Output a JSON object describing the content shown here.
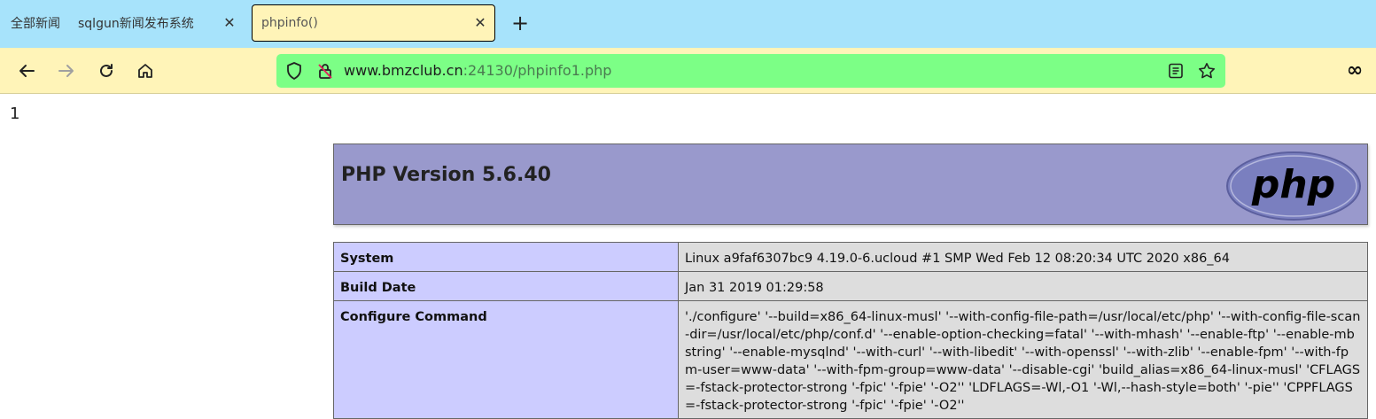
{
  "browser": {
    "tabs": [
      {
        "label": "全部新闻",
        "group": "sqlgun新闻发布系统",
        "active": false
      },
      {
        "label": "phpinfo()",
        "active": true
      }
    ],
    "url": {
      "host": "www.bmzclub.cn",
      "rest": ":24130/phpinfo1.php"
    },
    "colors": {
      "tabbar": "#a7e3fb",
      "toolbar": "#fff4b8",
      "urlbar": "#7cff86"
    }
  },
  "page": {
    "top_text": "1",
    "php_version_title": "PHP Version 5.6.40",
    "logo_text": "php",
    "rows": [
      {
        "key": "System",
        "value": "Linux a9faf6307bc9 4.19.0-6.ucloud #1 SMP Wed Feb 12 08:20:34 UTC 2020 x86_64"
      },
      {
        "key": "Build Date",
        "value": "Jan 31 2019 01:29:58"
      },
      {
        "key": "Configure Command",
        "value": "'./configure' '--build=x86_64-linux-musl' '--with-config-file-path=/usr/local/etc/php' '--with-config-file-scan-dir=/usr/local/etc/php/conf.d' '--enable-option-checking=fatal' '--with-mhash' '--enable-ftp' '--enable-mbstring' '--enable-mysqlnd' '--with-curl' '--with-libedit' '--with-openssl' '--with-zlib' '--enable-fpm' '--with-fpm-user=www-data' '--with-fpm-group=www-data' '--disable-cgi' 'build_alias=x86_64-linux-musl' 'CFLAGS=-fstack-protector-strong '-fpic' '-fpie' '-O2'' 'LDFLAGS=-Wl,-O1 '-Wl,--hash-style=both' '-pie'' 'CPPFLAGS=-fstack-protector-strong '-fpic' '-fpie' '-O2''"
      }
    ]
  }
}
